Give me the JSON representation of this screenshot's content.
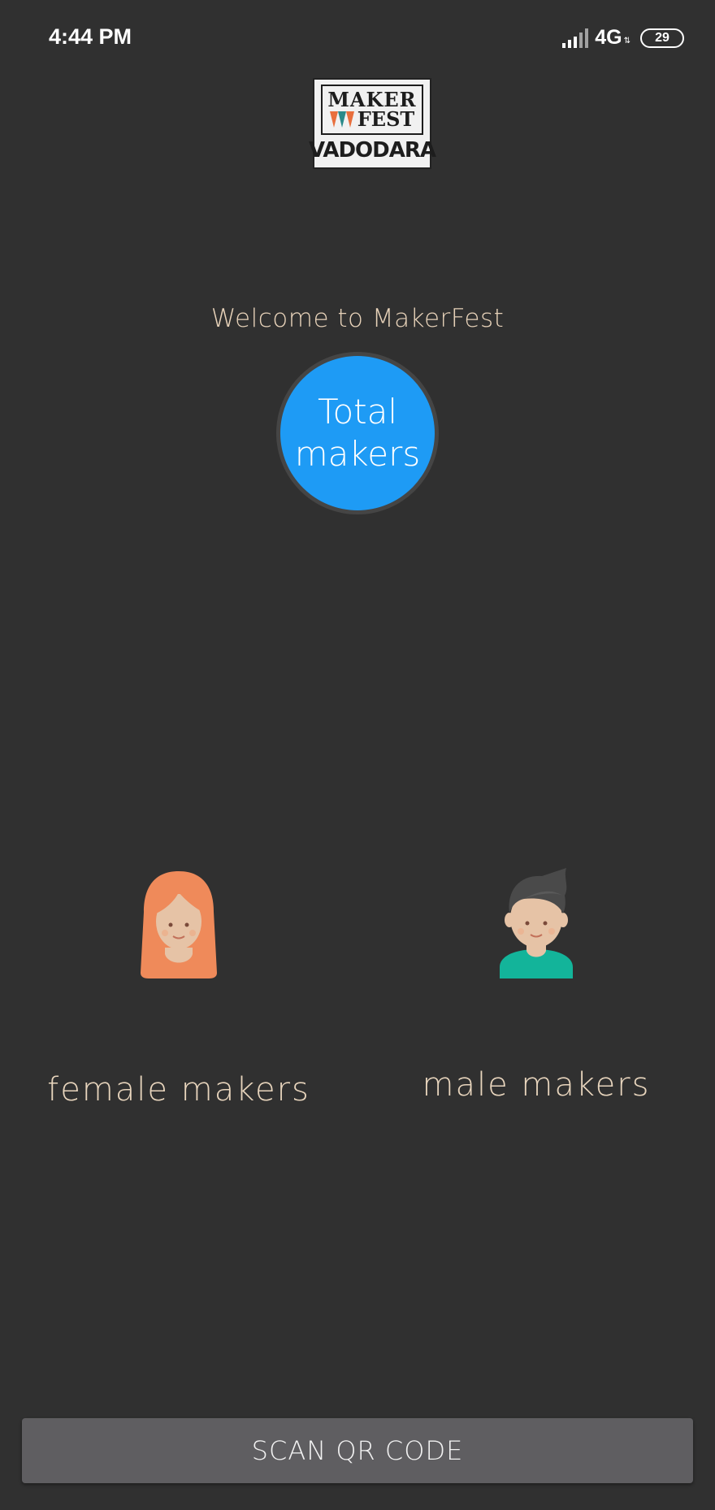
{
  "status_bar": {
    "time": "4:44 PM",
    "network": "4G",
    "battery": "29"
  },
  "logo": {
    "line1": "MAKER",
    "line2": "FEST",
    "city": "VADODARA"
  },
  "welcome_text": "Welcome to MakerFest",
  "total_makers": {
    "line1": "Total",
    "line2": "makers"
  },
  "female": {
    "label": "female makers",
    "icon": "female-avatar-icon"
  },
  "male": {
    "label": "male makers",
    "icon": "male-avatar-icon"
  },
  "scan_button_label": "SCAN QR CODE",
  "colors": {
    "background": "#303030",
    "accent_blue": "#1e9bf5",
    "text_beige": "#e8d5bd",
    "button_gray": "#5f5e61"
  }
}
